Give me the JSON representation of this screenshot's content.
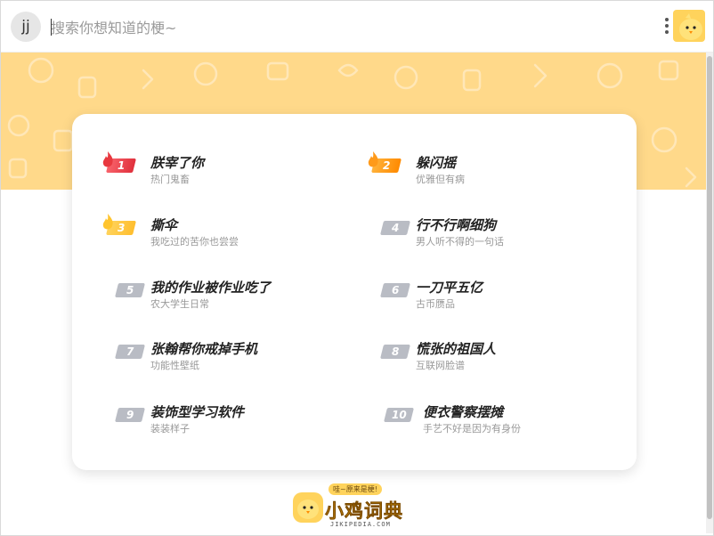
{
  "header": {
    "avatar_text": "jj",
    "search_placeholder": "搜索你想知道的梗~",
    "menu_icon": "kebab-menu-icon",
    "logo_icon": "chick-logo-icon"
  },
  "colors": {
    "banner": "#ffd98a",
    "accent": "#ffc93a",
    "rank1": "#e83a44",
    "rank2": "#ff9a1a",
    "rank3": "#ffc42e",
    "rank_plain": "#b9bcc4"
  },
  "hot_list": [
    {
      "rank": "1",
      "title": "朕宰了你",
      "subtitle": "热门鬼畜"
    },
    {
      "rank": "2",
      "title": "躲闪摇",
      "subtitle": "优雅但有病"
    },
    {
      "rank": "3",
      "title": "撕伞",
      "subtitle": "我吃过的苦你也尝尝"
    },
    {
      "rank": "4",
      "title": "行不行啊细狗",
      "subtitle": "男人听不得的一句话"
    },
    {
      "rank": "5",
      "title": "我的作业被作业吃了",
      "subtitle": "农大学生日常"
    },
    {
      "rank": "6",
      "title": "一刀平五亿",
      "subtitle": "古币赝品"
    },
    {
      "rank": "7",
      "title": "张翰帮你戒掉手机",
      "subtitle": "功能性壁纸"
    },
    {
      "rank": "8",
      "title": "慌张的祖国人",
      "subtitle": "互联网脸谱"
    },
    {
      "rank": "9",
      "title": "装饰型学习软件",
      "subtitle": "装装样子"
    },
    {
      "rank": "10",
      "title": "便衣警察摆摊",
      "subtitle": "手艺不好是因为有身份"
    }
  ],
  "footer": {
    "slogan": "哇~原来是梗!",
    "site_name": "小鸡词典",
    "domain": "JIKIPEDIA.COM"
  }
}
